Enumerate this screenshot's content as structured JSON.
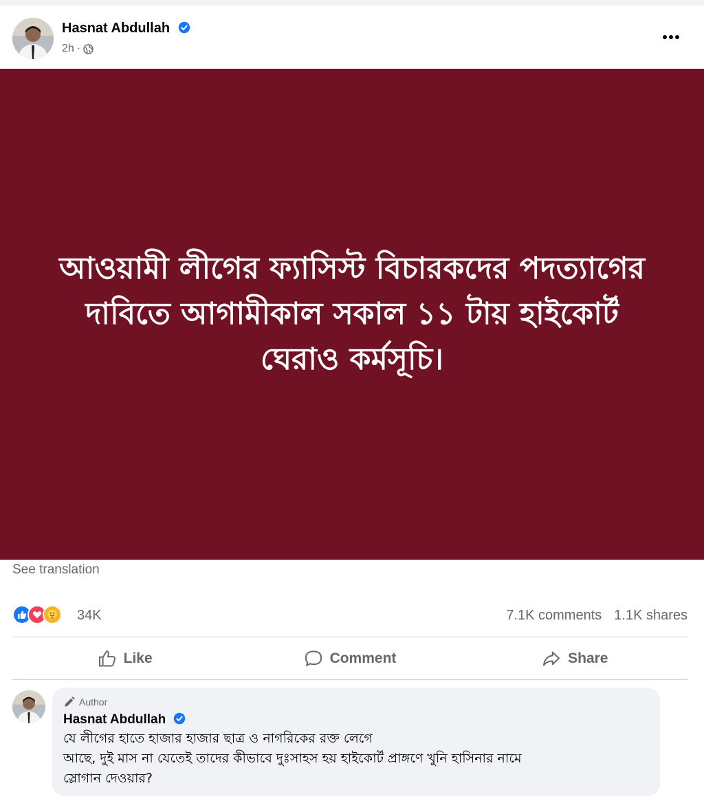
{
  "post": {
    "author_name": "Hasnat Abdullah",
    "time": "2h",
    "meta_separator": "·",
    "banner_text": "আওয়ামী লীগের ফ্যাসিস্ট বিচারকদের পদত্যাগের দাবিতে আগামীকাল সকাল ১১ টায় হাইকোর্ট ঘেরাও কর্মসূচি।",
    "see_translation": "See translation",
    "banner_color": "#701224"
  },
  "reactions": {
    "icons": [
      "like-icon",
      "love-icon",
      "care-icon"
    ],
    "count": "34K",
    "comments": "7.1K comments",
    "shares": "1.1K shares"
  },
  "actions": {
    "like": "Like",
    "comment": "Comment",
    "share": "Share"
  },
  "comment": {
    "badge": "Author",
    "author_name": "Hasnat Abdullah",
    "text": "যে লীগের হাতে হাজার হাজার ছাত্র ও নাগরিকের রক্ত লেগে\nআছে, দুই মাস না যেতেই তাদের কীভাবে দুঃসাহস হয় হাইকোর্ট প্রাঙ্গণে খুনি হাসিনার নামে\nস্লোগান দেওয়ার?"
  },
  "colors": {
    "facebook_blue": "#1877f2",
    "secondary_text": "#65676b",
    "love_red": "#f33e58",
    "care_yellow": "#f7b125"
  }
}
